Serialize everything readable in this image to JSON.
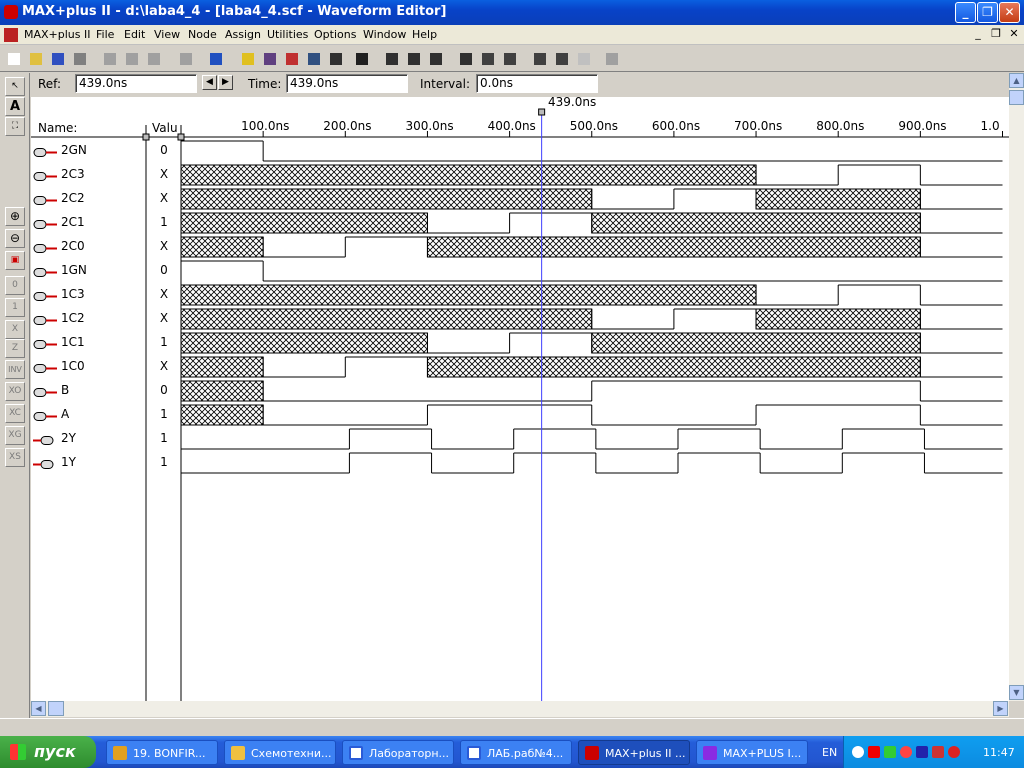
{
  "window": {
    "title": "MAX+plus II - d:\\laba4_4 - [laba4_4.scf - Waveform Editor]",
    "minimize": "_",
    "maximize": "❐",
    "close": "✕"
  },
  "menu": {
    "items": [
      "MAX+plus II",
      "File",
      "Edit",
      "View",
      "Node",
      "Assign",
      "Utilities",
      "Options",
      "Window",
      "Help"
    ],
    "mdi_minimize": "_",
    "mdi_restore": "❐",
    "mdi_close": "✕"
  },
  "colors": {
    "title_bar": "#0842c8",
    "cursor_line": "#4040ff",
    "waveform": "#000000",
    "taskbar": "#245dd9",
    "start_button": "#2e8c2e"
  },
  "toolbar_icons": [
    "new-icon",
    "open-icon",
    "save-icon",
    "print-icon",
    "cut-icon",
    "copy-icon",
    "paste-icon",
    "undo-icon",
    "help-icon",
    "compiler-icon",
    "waveform-editor-icon",
    "floorplan-icon",
    "timing-analyzer-icon",
    "programmer-icon",
    "hierarchy-icon",
    "project-save-icon",
    "project-compile-icon",
    "project-simulate-icon",
    "timing-icon",
    "open-sheet-icon",
    "eye-icon",
    "eye-all-icon",
    "group-icon",
    "ungroup-icon",
    "zoom-fit-icon"
  ],
  "left_tools": {
    "select": "↖",
    "text": "A",
    "ungroup": "⛶",
    "zoom_in": "⊕",
    "zoom_out": "⊖",
    "fit": "▣",
    "t0": "0",
    "t1": "1",
    "tx": "X",
    "tz": "Z",
    "inv": "INV",
    "ov": "XO",
    "oc": "XC",
    "og": "XG",
    "os": "XS"
  },
  "header": {
    "ref_label": "Ref:",
    "ref_value": "439.0ns",
    "time_label": "Time:",
    "time_value": "439.0ns",
    "interval_label": "Interval:",
    "interval_value": "0.0ns",
    "cursor_label": "439.0ns",
    "name_col": "Name:",
    "value_col": "Valu"
  },
  "timeline": {
    "ticks": [
      "100.0ns",
      "200.0ns",
      "300.0ns",
      "400.0ns",
      "500.0ns",
      "600.0ns",
      "700.0ns",
      "800.0ns",
      "900.0ns",
      "1.0"
    ],
    "cursor_time_ns": 439
  },
  "signals": [
    {
      "name": "2GN",
      "value": "0",
      "type": "input"
    },
    {
      "name": "2C3",
      "value": "X",
      "type": "input"
    },
    {
      "name": "2C2",
      "value": "X",
      "type": "input"
    },
    {
      "name": "2C1",
      "value": "1",
      "type": "input"
    },
    {
      "name": "2C0",
      "value": "X",
      "type": "input"
    },
    {
      "name": "1GN",
      "value": "0",
      "type": "input"
    },
    {
      "name": "1C3",
      "value": "X",
      "type": "input"
    },
    {
      "name": "1C2",
      "value": "X",
      "type": "input"
    },
    {
      "name": "1C1",
      "value": "1",
      "type": "input"
    },
    {
      "name": "1C0",
      "value": "X",
      "type": "input"
    },
    {
      "name": "B",
      "value": "0",
      "type": "input"
    },
    {
      "name": "A",
      "value": "1",
      "type": "input"
    },
    {
      "name": "2Y",
      "value": "1",
      "type": "output"
    },
    {
      "name": "1Y",
      "value": "1",
      "type": "output"
    }
  ],
  "taskbar": {
    "start": "пуск",
    "tasks": [
      "19. BONFIR...",
      "Схемотехни...",
      "Лабораторн...",
      "ЛАБ.раб№4...",
      "MAX+plus II ...",
      "MAX+PLUS I..."
    ],
    "language": "EN",
    "clock": "11:47"
  }
}
